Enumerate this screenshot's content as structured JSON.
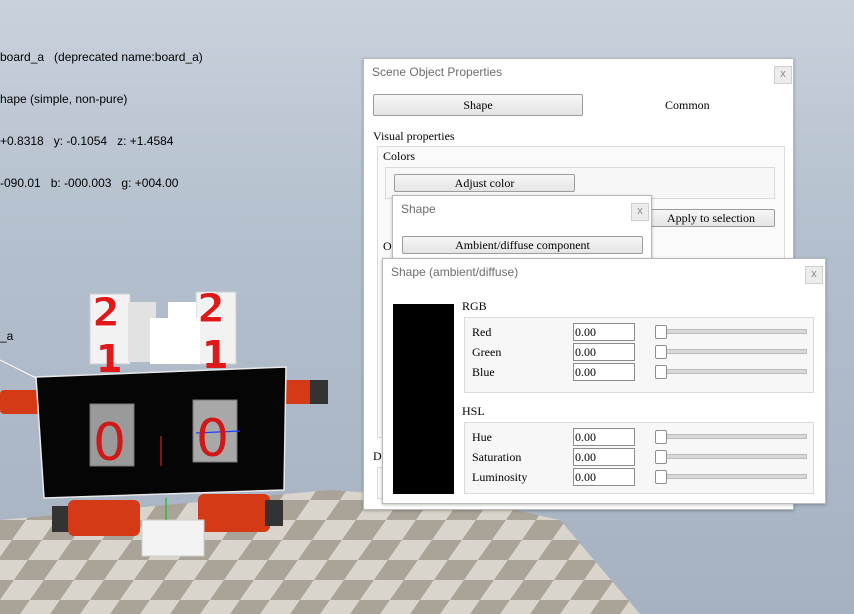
{
  "hud": {
    "line1": "board_a   (deprecated name:board_a)",
    "line2": "hape (simple, non-pure)",
    "line3": "+0.8318   y: -0.1054   z: +1.4584",
    "line4": "-090.01   b: -000.003   g: +004.00"
  },
  "scene": {
    "object_label": "_a",
    "cube_digit_a": "2",
    "cube_digit_b": "1",
    "cube_digit_c": "2",
    "cube_digit_d": "1",
    "board_digit_left": "0",
    "board_digit_right": "0"
  },
  "scene_props": {
    "title": "Scene Object Properties",
    "close": "x",
    "tab_shape": "Shape",
    "tab_common": "Common",
    "visual_properties": "Visual properties",
    "colors_label": "Colors",
    "adjust_color": "Adjust color",
    "apply_to_selection": "Apply to selection",
    "other_label_partial": "O",
    "d_label_partial": "D"
  },
  "shape_dialog": {
    "title": "Shape",
    "close": "x",
    "ambient_diffuse": "Ambient/diffuse component"
  },
  "color_dialog": {
    "title": "Shape (ambient/diffuse)",
    "close": "x",
    "preview_color": "#000000",
    "rgb_label": "RGB",
    "hsl_label": "HSL",
    "red_label": "Red",
    "red_value": "0.00",
    "green_label": "Green",
    "green_value": "0.00",
    "blue_label": "Blue",
    "blue_value": "0.00",
    "hue_label": "Hue",
    "hue_value": "0.00",
    "saturation_label": "Saturation",
    "saturation_value": "0.00",
    "luminosity_label": "Luminosity",
    "luminosity_value": "0.00"
  }
}
